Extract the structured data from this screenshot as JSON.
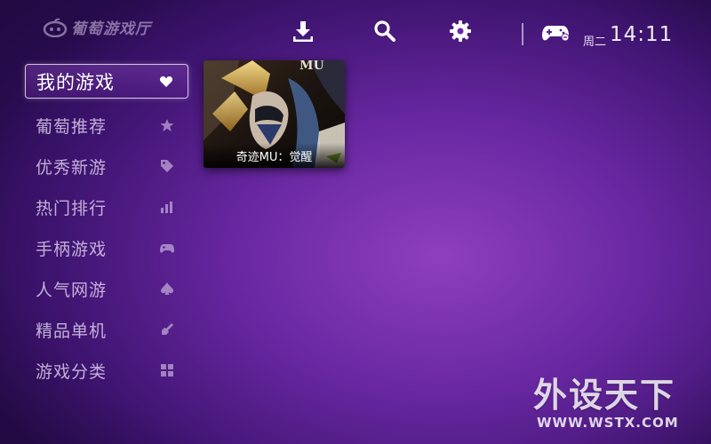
{
  "app": {
    "name": "葡萄游戏厅"
  },
  "header": {
    "icons": [
      "download-icon",
      "search-icon",
      "gear-icon",
      "gamepad-icon"
    ],
    "weekday": "周二",
    "time": "14:11"
  },
  "sidebar": {
    "items": [
      {
        "label": "我的游戏",
        "icon": "heart-icon",
        "active": true
      },
      {
        "label": "葡萄推荐",
        "icon": "star-icon"
      },
      {
        "label": "优秀新游",
        "icon": "tag-icon"
      },
      {
        "label": "热门排行",
        "icon": "bar-chart-icon"
      },
      {
        "label": "手柄游戏",
        "icon": "gamepad-icon"
      },
      {
        "label": "人气网游",
        "icon": "spade-icon"
      },
      {
        "label": "精品单机",
        "icon": "wrench-icon"
      },
      {
        "label": "游戏分类",
        "icon": "grid-icon"
      }
    ]
  },
  "games": [
    {
      "title": "奇迹MU：觉醒",
      "art_text": "MU"
    }
  ],
  "watermark": {
    "cn": "外设天下",
    "en": "WWW.WSTX.COM"
  },
  "colors": {
    "background": "#6a28a3",
    "accent": "#ffffff"
  }
}
